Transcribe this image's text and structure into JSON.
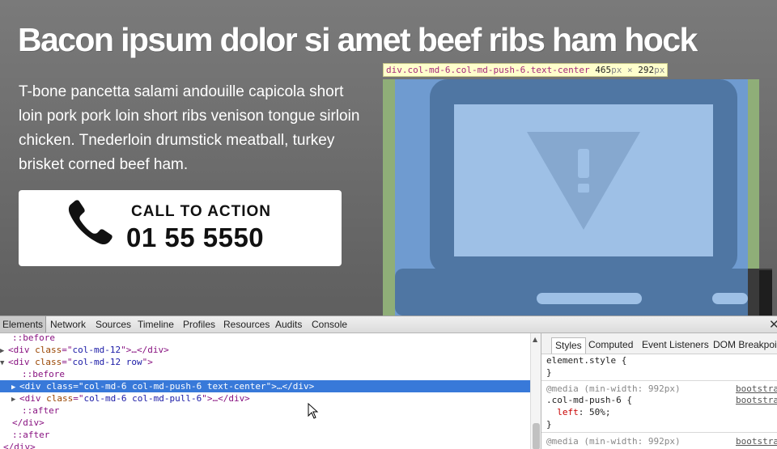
{
  "page": {
    "headline": "Bacon ipsum dolor si amet beef ribs ham hock",
    "lead": "T-bone pancetta salami andouille capicola short loin pork pork loin short ribs venison tongue sirloin chicken. Tnederloin drumstick meatball, turkey brisket corned beef ham.",
    "cta": {
      "label": "CALL TO ACTION",
      "number": "01 55 5550",
      "icon": "phone-icon"
    },
    "laptop_icon": "laptop-warning-icon"
  },
  "highlight_tooltip": {
    "selector": "div.col-md-6.col-md-push-6.text-center",
    "width": "465",
    "unit_w": "px",
    "times": " × ",
    "height": "292",
    "unit_h": "px"
  },
  "devtools": {
    "tabs": [
      "Elements",
      "Network",
      "Sources",
      "Timeline",
      "Profiles",
      "Resources",
      "Audits",
      "Console"
    ],
    "active_tab": "Elements",
    "close": "✕",
    "dom": {
      "before1": "::before",
      "l1_tag": "div",
      "l1_attr": "class",
      "l1_val": "col-md-12",
      "l1_rest": ">…</div>",
      "l2_tag": "div",
      "l2_attr": "class",
      "l2_val": "col-md-12 row",
      "l2_rest": ">",
      "before2": "::before",
      "l3_tag": "div",
      "l3_attr": "class",
      "l3_val": "col-md-6 col-md-push-6 text-center",
      "l3_rest": ">…</div>",
      "l4_tag": "div",
      "l4_attr": "class",
      "l4_val": "col-md-6 col-md-pull-6",
      "l4_rest": ">…</div>",
      "after1": "::after",
      "close_div": "</div>",
      "after2": "::after",
      "close_div2": "</div>"
    },
    "styles": {
      "tabs": [
        "Styles",
        "Computed",
        "Event Listeners",
        "DOM Breakpoints"
      ],
      "active_tab": "Styles",
      "element_style": "element.style {",
      "close_brace": "}",
      "media1": "@media (min-width: 992px)",
      "source1": "bootstrap",
      "source1b": "bootstrap",
      "rule1": ".col-md-push-6 {",
      "prop1_name": "left",
      "prop1_value": "50%;",
      "media2": "@media (min-width: 992px)",
      "source2": "bootstrap"
    }
  },
  "colors": {
    "page_bg": "#6e6e6e",
    "highlight_blue": "#6f9ed6",
    "highlight_green": "#8fb07a",
    "selection": "#3879d9"
  }
}
